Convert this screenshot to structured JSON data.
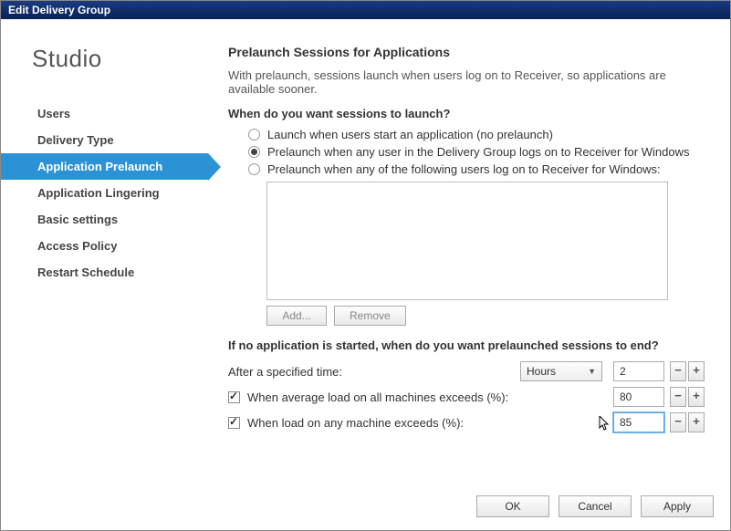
{
  "window": {
    "title": "Edit Delivery Group"
  },
  "brand": "Studio",
  "nav": {
    "users": "Users",
    "delivery_type": "Delivery Type",
    "application_prelaunch": "Application Prelaunch",
    "application_lingering": "Application Lingering",
    "basic_settings": "Basic settings",
    "access_policy": "Access Policy",
    "restart_schedule": "Restart Schedule"
  },
  "main": {
    "title": "Prelaunch Sessions for Applications",
    "desc": "With prelaunch, sessions launch when users log on to Receiver, so applications are available sooner.",
    "question": "When do you want sessions to launch?",
    "radio1": "Launch when users start an application (no prelaunch)",
    "radio2": "Prelaunch when any user in the Delivery Group logs on to Receiver for Windows",
    "radio3": "Prelaunch when any of the following users log on to Receiver for Windows:",
    "add": "Add...",
    "remove": "Remove",
    "question2": "If no application is started, when do you want prelaunched sessions to end?",
    "after_time_label": "After a specified time:",
    "unit_value": "Hours",
    "time_value": "2",
    "avg_load_label": "When average load on all machines exceeds (%):",
    "avg_load_value": "80",
    "any_load_label": "When load on any machine exceeds (%):",
    "any_load_value": "85",
    "minus": "−",
    "plus": "+"
  },
  "buttons": {
    "ok": "OK",
    "cancel": "Cancel",
    "apply": "Apply"
  }
}
